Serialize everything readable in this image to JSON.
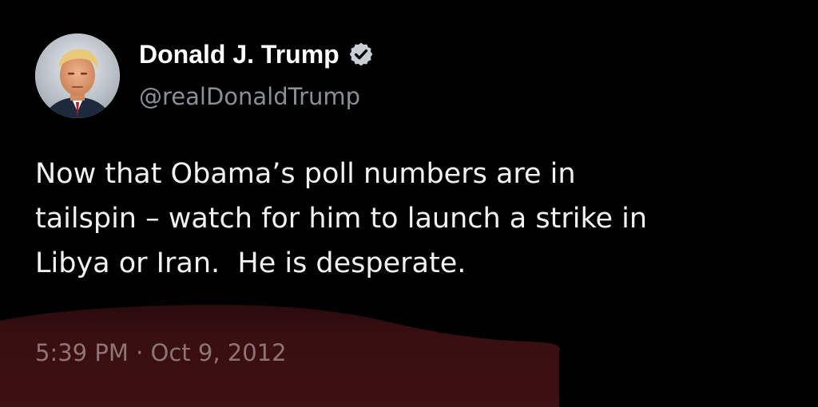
{
  "author": {
    "name": "Donald J. Trump",
    "handle": "@realDonaldTrump",
    "verified": true,
    "avatar_icon": "profile-photo-avatar",
    "verified_icon": "verified-badge-icon"
  },
  "tweet": {
    "lines": [
      "Now that Obama’s poll numbers are in",
      "tailspin – watch for him to launch a strike in",
      "Libya or Iran.  He is desperate."
    ]
  },
  "meta": {
    "timestamp": "5:39 PM · Oct 9, 2012"
  },
  "colors": {
    "background": "#000000",
    "text": "#f1f1f1",
    "secondary_text": "#8b9096",
    "highlight_smudge": "#3a0f12"
  }
}
